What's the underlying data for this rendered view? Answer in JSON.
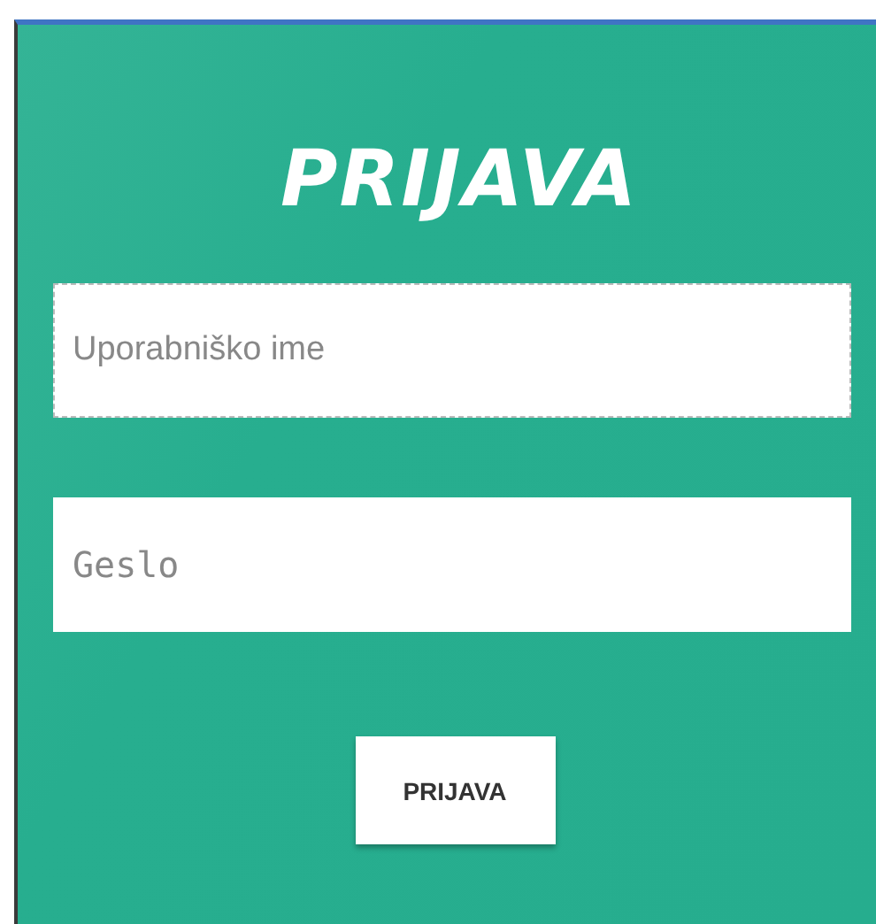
{
  "title": "PRIJAVA",
  "fields": [
    {
      "kind": "text",
      "placeholder": "Uporabniško ime",
      "focused": true
    },
    {
      "kind": "password",
      "placeholder": "Geslo",
      "focused": false
    }
  ],
  "button": "PRIJAVA"
}
